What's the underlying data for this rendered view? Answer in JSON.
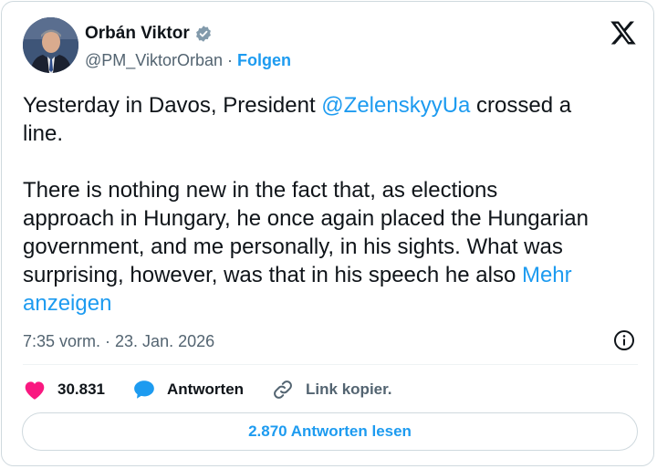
{
  "author": {
    "name": "Orbán Viktor",
    "handle": "@PM_ViktorOrban",
    "separator": "·",
    "follow_label": "Folgen"
  },
  "tweet": {
    "text_part1": "Yesterday in Davos, President ",
    "mention": "@ZelenskyyUa",
    "text_part2": " crossed a\nline.\n\nThere is nothing new in the fact that, as elections\napproach in Hungary, he once again placed the Hungarian\ngovernment, and me personally, in his sights. What was\nsurprising, however, was that in his speech he also ",
    "more_label": "Mehr\nanzeigen",
    "timestamp": "7:35 vorm. · 23. Jan. 2026"
  },
  "actions": {
    "likes_count": "30.831",
    "reply_label": "Antworten",
    "copy_link_label": "Link kopier."
  },
  "read_replies_label": "2.870 Antworten lesen",
  "icons": {
    "verified": "verified-badge-icon",
    "logo": "x-logo-icon",
    "info": "info-icon",
    "like": "heart-icon",
    "reply": "speech-bubble-icon",
    "copy_link": "link-icon"
  },
  "colors": {
    "accent": "#1d9bf0",
    "like": "#f91880",
    "text": "#0f1419",
    "muted": "#536471"
  }
}
